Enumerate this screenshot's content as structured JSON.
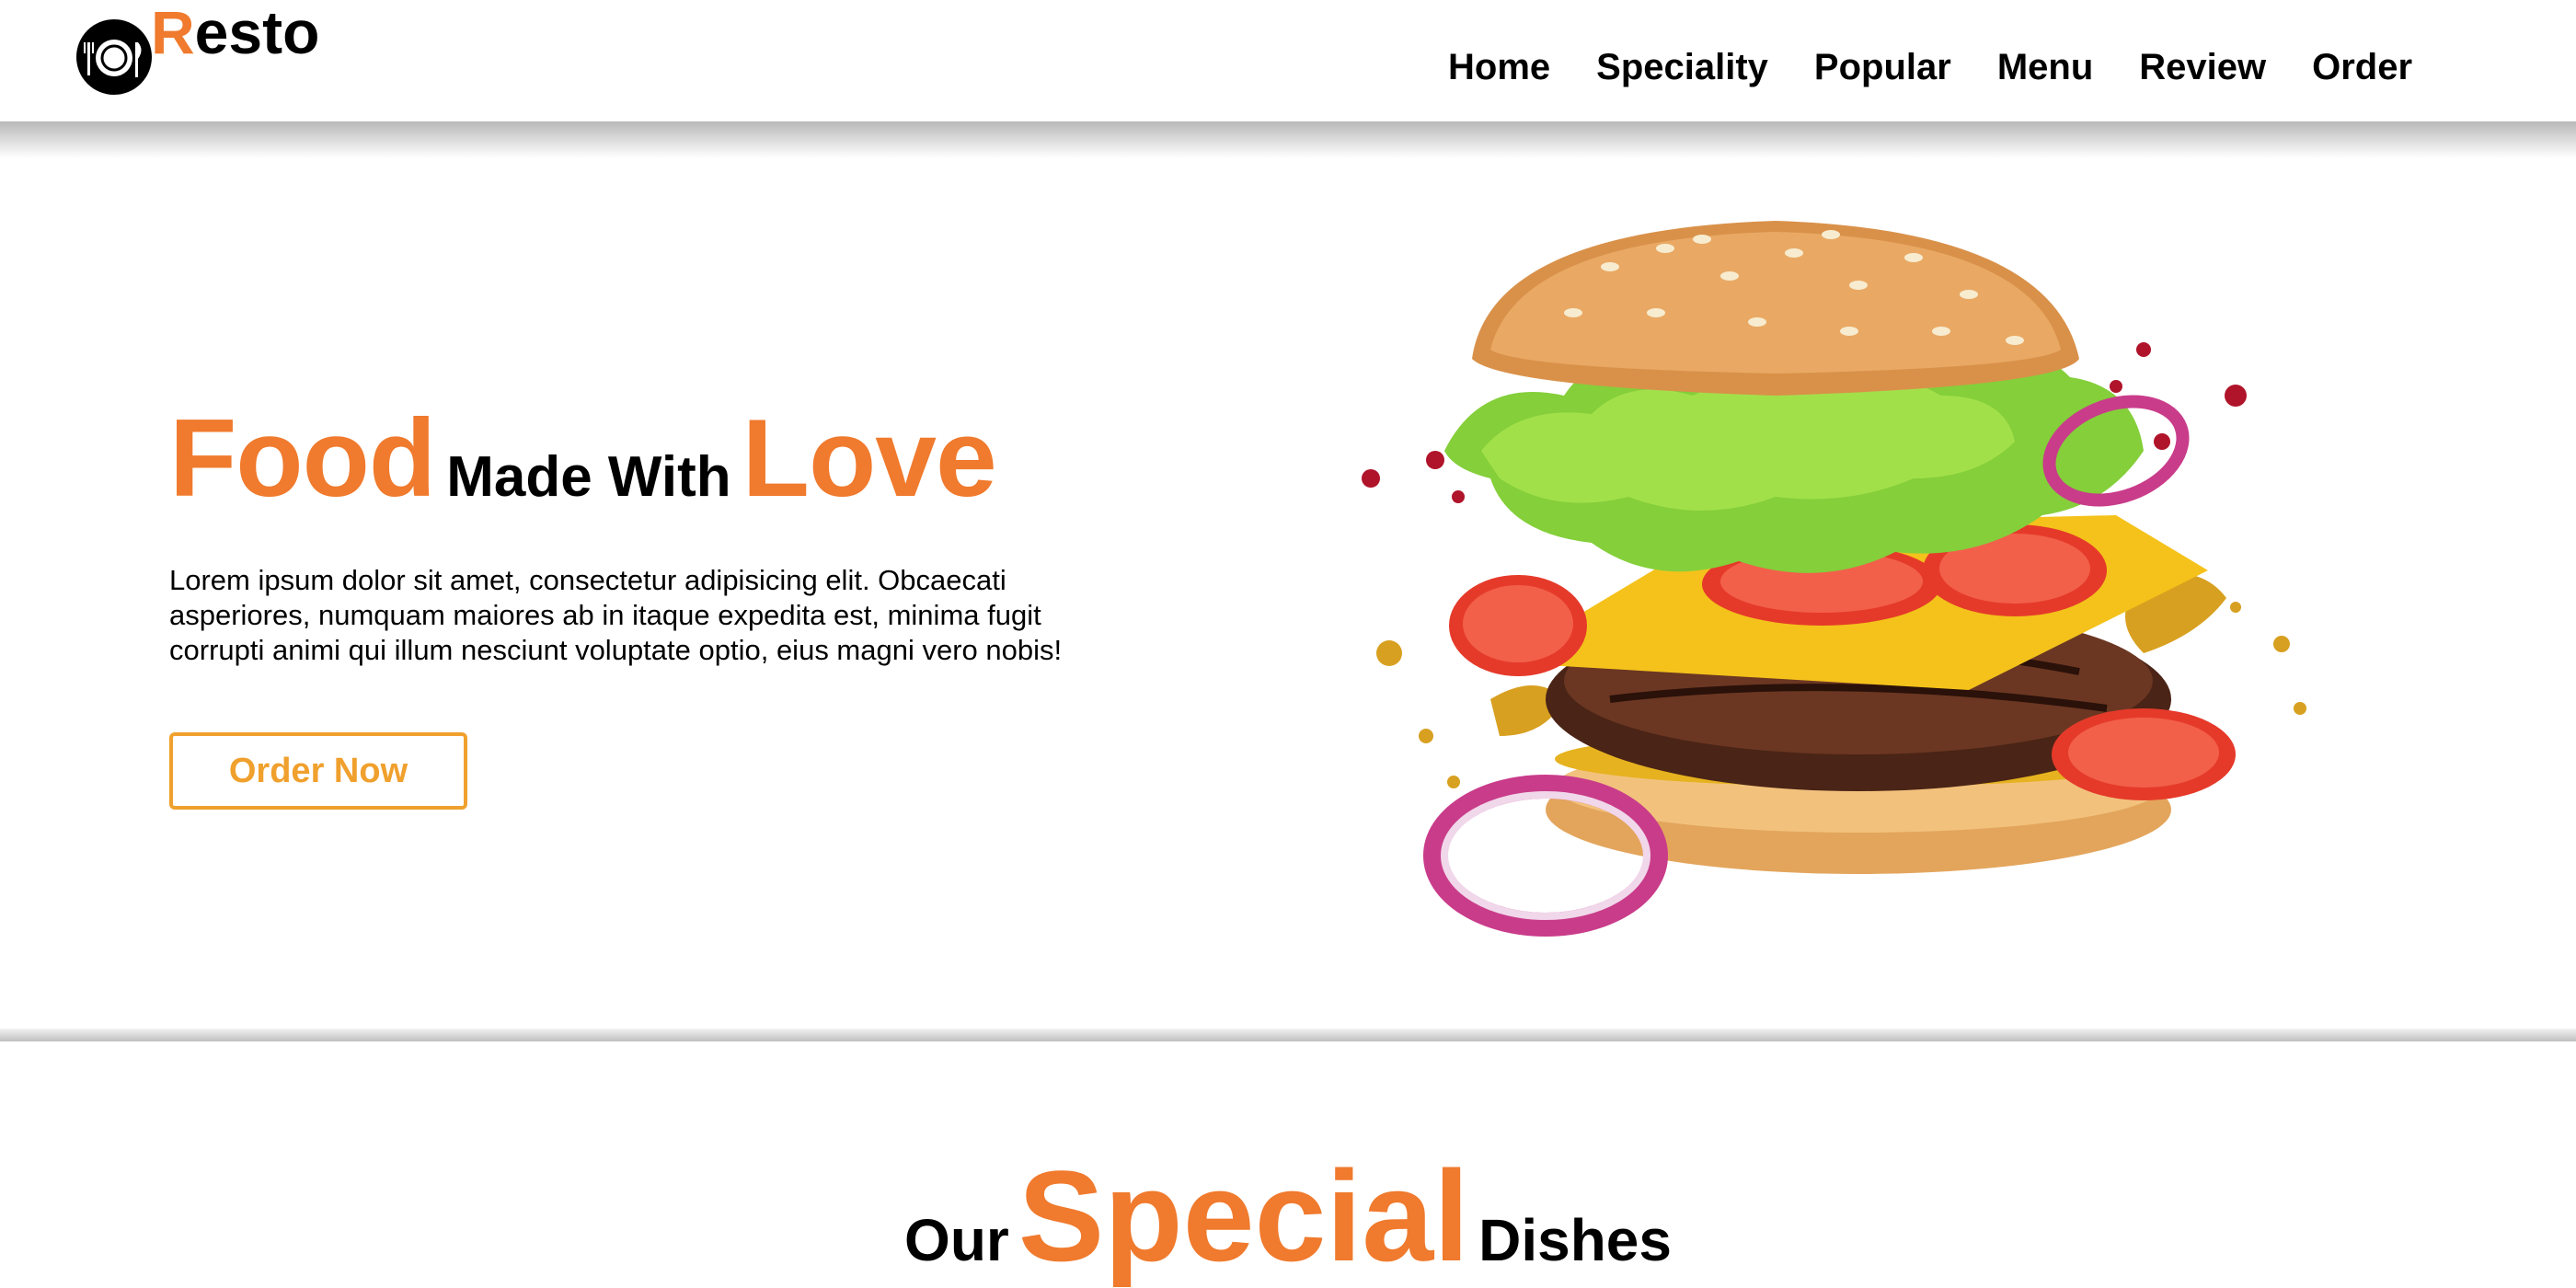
{
  "brand": {
    "first_letter": "R",
    "rest": "esto",
    "icon": "plate-cutlery-icon"
  },
  "nav": {
    "items": [
      {
        "label": "Home"
      },
      {
        "label": "Speciality"
      },
      {
        "label": "Popular"
      },
      {
        "label": "Menu"
      },
      {
        "label": "Review"
      },
      {
        "label": "Order"
      }
    ]
  },
  "hero": {
    "title_word_1": "Food",
    "title_middle": "Made With",
    "title_word_2": "Love",
    "description": "Lorem ipsum dolor sit amet, consectetur adipisicing elit. Obcaecati asperiores, numquam maiores ab in itaque expedita est, minima fugit corrupti animi qui illum nesciunt voluptate optio, eius magni vero nobis!",
    "button_label": "Order Now",
    "image": "burger-image"
  },
  "special": {
    "prefix": "Our",
    "highlight": "Special",
    "suffix": "Dishes"
  },
  "colors": {
    "accent": "#f07a2d",
    "button": "#f0a02d",
    "text": "#000000",
    "background": "#ffffff"
  }
}
